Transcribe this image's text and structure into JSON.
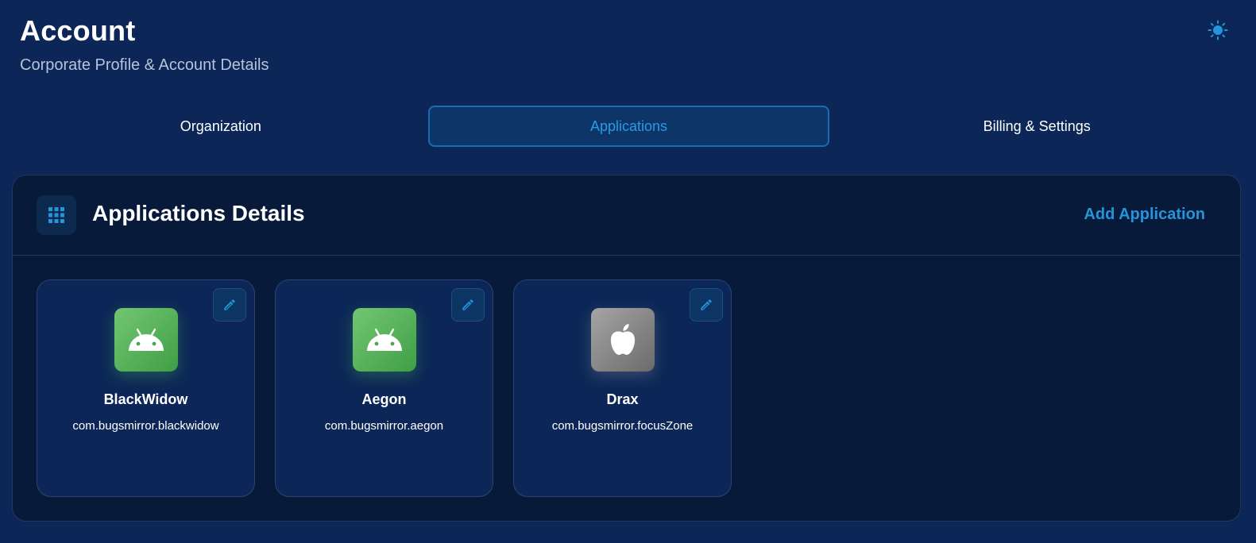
{
  "header": {
    "title": "Account",
    "subtitle": "Corporate Profile & Account Details",
    "theme_toggle_icon": "sun-icon"
  },
  "tabs": [
    {
      "label": "Organization",
      "active": false
    },
    {
      "label": "Applications",
      "active": true
    },
    {
      "label": "Billing & Settings",
      "active": false
    }
  ],
  "panel": {
    "icon": "grid-icon",
    "title": "Applications Details",
    "add_label": "Add Application"
  },
  "applications": [
    {
      "name": "BlackWidow",
      "package": "com.bugsmirror.blackwidow",
      "platform": "android",
      "icon": "android-icon"
    },
    {
      "name": "Aegon",
      "package": "com.bugsmirror.aegon",
      "platform": "android",
      "icon": "android-icon"
    },
    {
      "name": "Drax",
      "package": "com.bugsmirror.focusZone",
      "platform": "ios",
      "icon": "apple-icon"
    }
  ],
  "colors": {
    "background": "#0c2757",
    "panel": "#071a3a",
    "accent": "#2494db",
    "android_green": "#4caf50",
    "ios_gray": "#8a8a8a"
  }
}
